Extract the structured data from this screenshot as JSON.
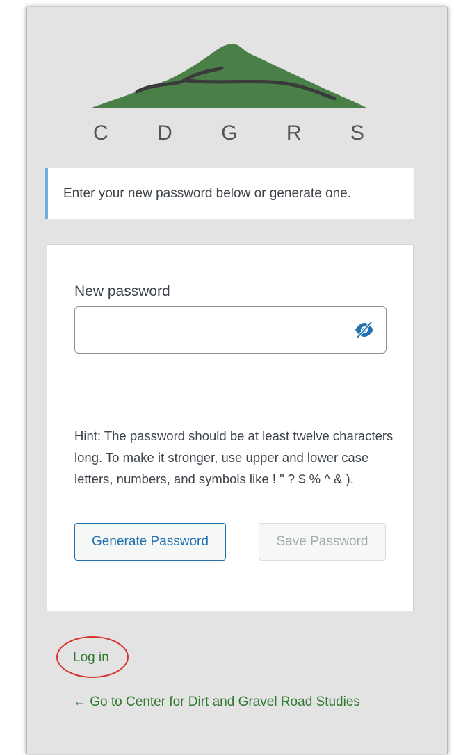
{
  "logo": {
    "letters": [
      "C",
      "D",
      "G",
      "R",
      "S"
    ],
    "mountain_color": "#4a7f48",
    "road_color": "#3a3a3a"
  },
  "message": "Enter your new password below or generate one.",
  "form": {
    "new_password_label": "New password",
    "password_value": "",
    "toggle_icon": "eye-slash-icon",
    "hint": "Hint: The password should be at least twelve characters long. To make it stronger, use upper and lower case letters, numbers, and symbols like ! \" ? $ % ^ & ).",
    "generate_label": "Generate Password",
    "save_label": "Save Password"
  },
  "nav": {
    "login_label": "Log in",
    "back_label": "← Go to Center for Dirt and Gravel Road Studies"
  },
  "colors": {
    "accent": "#2271b1",
    "link": "#2f7a2f",
    "message_border": "#72aee6",
    "annotation": "#d9322d"
  }
}
